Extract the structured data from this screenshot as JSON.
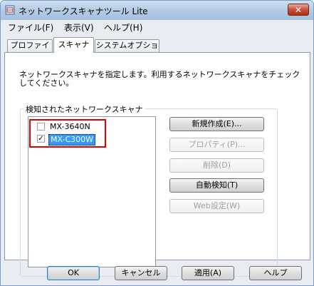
{
  "window": {
    "title": "ネットワークスキャナツール Lite",
    "close_glyph": "✕"
  },
  "menu": [
    "ファイル(F)",
    "表示(V)",
    "ヘルプ(H)"
  ],
  "tabs": [
    "プロファイル",
    "スキャナ",
    "システムオプション"
  ],
  "active_tab": "スキャナ",
  "description": "ネットワークスキャナを指定します。利用するネットワークスキャナをチェックしてください。",
  "group": {
    "label": "検知されたネットワークスキャナ",
    "scanners": [
      {
        "name": "MX-3640N",
        "checked": false
      },
      {
        "name": "MX-C300W",
        "checked": true,
        "selected": true
      }
    ]
  },
  "side_buttons": {
    "new": "新規作成(E)...",
    "properties": "プロパティ(P)...",
    "delete": "削除(D)",
    "auto_detect": "自動検知(T)",
    "web_settings": "Web設定(W)"
  },
  "bottom_buttons": {
    "ok": "OK",
    "cancel": "キャンセル",
    "apply": "適用(A)",
    "help": "ヘルプ"
  },
  "colors": {
    "highlight": "#dd0000",
    "selection": "#3399ff"
  }
}
